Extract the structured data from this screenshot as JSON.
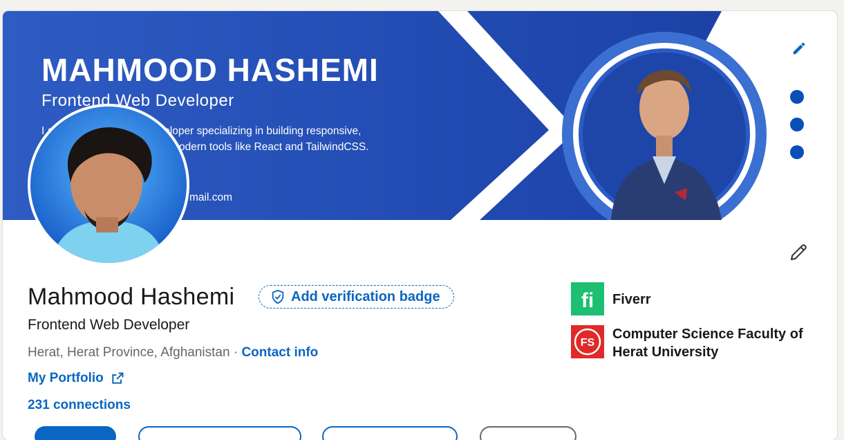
{
  "banner": {
    "title": "MAHMOOD HASHEMI",
    "subtitle": "Frontend Web Developer",
    "desc_line1": "I am a Frontend Web Developer specializing in building responsive,",
    "desc_line2": "user-friendly websites with modern tools like React and TailwindCSS.",
    "email_visible": "mail.com"
  },
  "profile": {
    "name": "Mahmood Hashemi",
    "verify_label": "Add verification badge",
    "headline": "Frontend Web Developer",
    "location": "Herat, Herat Province, Afghanistan",
    "separator": " · ",
    "contact_label": "Contact info",
    "portfolio_label": "My Portfolio",
    "connections_label": "231 connections"
  },
  "orgs": [
    {
      "name": "Fiverr",
      "logo_text": "fi",
      "color": "#1dbf73"
    },
    {
      "name": "Computer Science Faculty of Herat University",
      "logo_text": "FS",
      "color": "#e02a2a"
    }
  ],
  "colors": {
    "link": "#0a66c2",
    "banner": "#2049b0",
    "page_bg": "#f4f2ee"
  },
  "icons": [
    "pencil-icon",
    "edit-icon",
    "shield-check-icon",
    "external-link-icon"
  ]
}
